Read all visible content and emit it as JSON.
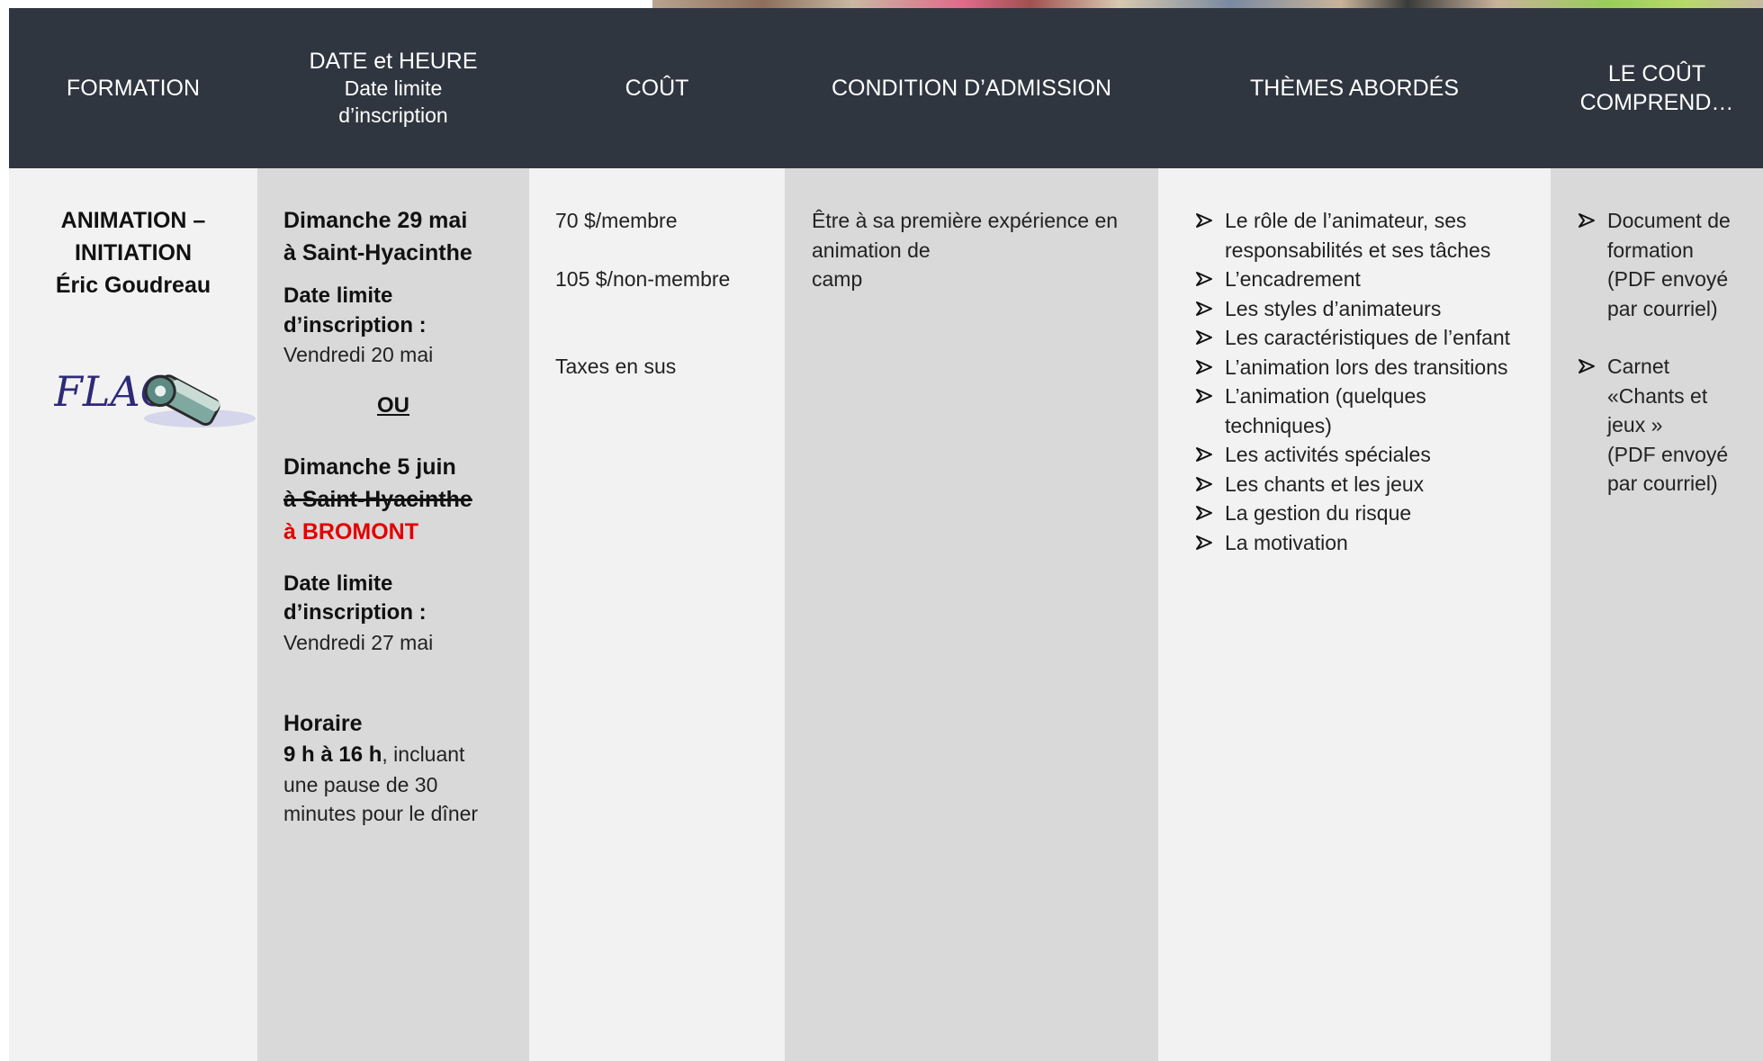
{
  "headers": {
    "formation": "FORMATION",
    "date_line1": "DATE et HEURE",
    "date_line2": "Date limite",
    "date_line3": "d’inscription",
    "cout": "COÛT",
    "condition": "CONDITION D’ADMISSION",
    "themes": "THÈMES ABORDÉS",
    "comprend_line1": "LE COÛT",
    "comprend_line2": "COMPREND…"
  },
  "formation": {
    "title_line1": "ANIMATION –",
    "title_line2": "INITIATION",
    "instructor": "Éric Goudreau",
    "logo_text": "FLAC"
  },
  "dates": {
    "session1_line1": "Dimanche 29 mai",
    "session1_line2": "à Saint-Hyacinthe",
    "deadline_label_line1": "Date limite",
    "deadline_label_line2": "d’inscription :",
    "deadline1": "Vendredi 20 mai",
    "or": "OU",
    "session2_line1": "Dimanche 5 juin",
    "session2_struck": "à Saint-Hyacinthe",
    "session2_new": "à BROMONT",
    "deadline2": "Vendredi 27 mai",
    "schedule_label": "Horaire",
    "schedule_hours": "9 h à 16 h",
    "schedule_rest_line1": ", incluant",
    "schedule_rest_line2": "une pause de 30",
    "schedule_rest_line3": "minutes pour le dîner"
  },
  "cost": {
    "member": "70 $/membre",
    "non_member": "105 $/non-membre",
    "taxes": "Taxes en sus"
  },
  "condition": {
    "line1": "Être à sa première expérience en",
    "line2": "animation de",
    "line3": "camp"
  },
  "themes": [
    {
      "line1": "Le rôle de l’animateur, ses",
      "line2": "responsabilités et ses tâches"
    },
    {
      "line1": "L’encadrement"
    },
    {
      "line1": "Les styles d’animateurs"
    },
    {
      "line1": "Les caractéristiques de l’enfant"
    },
    {
      "line1": "L’animation lors des transitions"
    },
    {
      "line1": "L’animation (quelques",
      "line2": "techniques)"
    },
    {
      "line1": "Les activités spéciales"
    },
    {
      "line1": "Les chants et les jeux"
    },
    {
      "line1": "La gestion du risque"
    },
    {
      "line1": "La motivation"
    }
  ],
  "includes": {
    "item1_line1": "Document de",
    "item1_line2": "formation",
    "item1_line3": "(PDF envoyé",
    "item1_line4": "par courriel)",
    "item2_line1": "Carnet",
    "item2_line2": "«Chants et",
    "item2_line3": "jeux »",
    "item2_line4": "(PDF envoyé",
    "item2_line5": "par courriel)"
  },
  "colors": {
    "header_bg": "#2f3640",
    "column_light": "#f2f2f2",
    "column_dark": "#d9d9d9",
    "accent_red": "#e30000"
  }
}
